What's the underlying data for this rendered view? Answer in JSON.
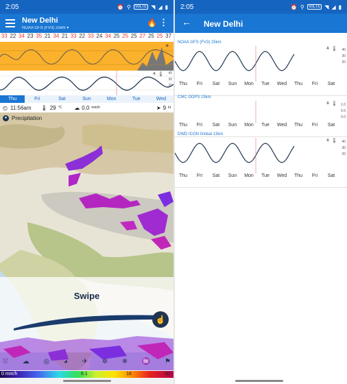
{
  "status": {
    "time": "2:05",
    "wifi_badge": "VoLTE"
  },
  "left": {
    "app_title": "New Delhi",
    "app_subtitle": "NOAA GFS (FV3) 25km",
    "temps": [
      "33",
      "22",
      "34",
      "23",
      "35",
      "21",
      "34",
      "21",
      "33",
      "22",
      "33",
      "24",
      "34",
      "25",
      "25",
      "25",
      "27",
      "25",
      "25",
      "37"
    ],
    "days": [
      "Thu",
      "Fri",
      "Sat",
      "Sun",
      "Mon",
      "Tue",
      "Wed"
    ],
    "info": {
      "time": "11:56am",
      "temp": "29",
      "temp_unit": "°C",
      "rain": "0.0",
      "rain_unit": "mm/h",
      "wind": "9",
      "wind_unit": "kt"
    },
    "layer": "Precipitation",
    "swipe": "Swipe",
    "legend": {
      "unit": "0 mm/h",
      "mid1": "6.1",
      "mid2": "18",
      "max": "50"
    }
  },
  "right": {
    "app_title": "New Delhi",
    "models": [
      {
        "name": "NOAA GFS (FV3) 25km",
        "axis": [
          "40",
          "30",
          "20"
        ]
      },
      {
        "name": "CMC GDPS 15km",
        "axis": [
          "1.0",
          "0.5",
          "0.0"
        ]
      },
      {
        "name": "DWD ICON Global 13km",
        "axis": [
          "40",
          "30",
          "20"
        ]
      }
    ],
    "days": [
      "Thu",
      "Fri",
      "Sat",
      "Sun",
      "Mon",
      "Tue",
      "Wed",
      "Thu",
      "Fri",
      "Sat"
    ]
  },
  "colors": {
    "statusbar": "#1565c0",
    "appbar": "#1976d2",
    "temp_band": "#fbb12b",
    "line": "#1f3550"
  }
}
